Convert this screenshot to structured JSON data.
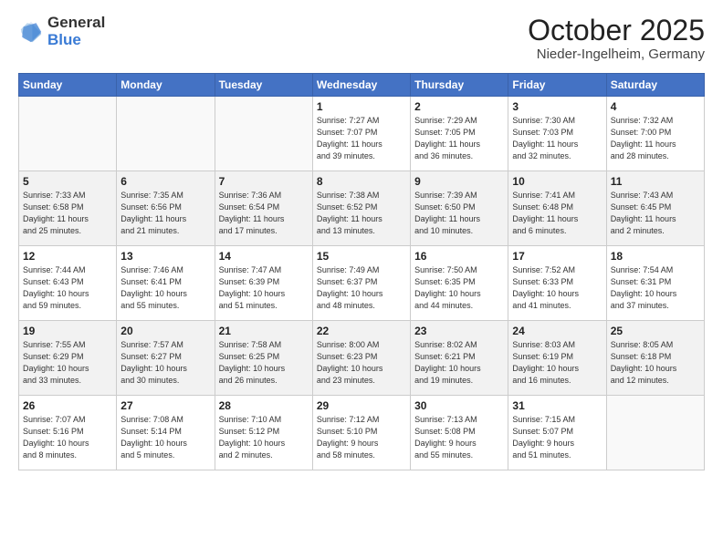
{
  "header": {
    "logo_general": "General",
    "logo_blue": "Blue",
    "title": "October 2025",
    "subtitle": "Nieder-Ingelheim, Germany"
  },
  "days_of_week": [
    "Sunday",
    "Monday",
    "Tuesday",
    "Wednesday",
    "Thursday",
    "Friday",
    "Saturday"
  ],
  "weeks": [
    [
      {
        "day": "",
        "info": ""
      },
      {
        "day": "",
        "info": ""
      },
      {
        "day": "",
        "info": ""
      },
      {
        "day": "1",
        "info": "Sunrise: 7:27 AM\nSunset: 7:07 PM\nDaylight: 11 hours\nand 39 minutes."
      },
      {
        "day": "2",
        "info": "Sunrise: 7:29 AM\nSunset: 7:05 PM\nDaylight: 11 hours\nand 36 minutes."
      },
      {
        "day": "3",
        "info": "Sunrise: 7:30 AM\nSunset: 7:03 PM\nDaylight: 11 hours\nand 32 minutes."
      },
      {
        "day": "4",
        "info": "Sunrise: 7:32 AM\nSunset: 7:00 PM\nDaylight: 11 hours\nand 28 minutes."
      }
    ],
    [
      {
        "day": "5",
        "info": "Sunrise: 7:33 AM\nSunset: 6:58 PM\nDaylight: 11 hours\nand 25 minutes."
      },
      {
        "day": "6",
        "info": "Sunrise: 7:35 AM\nSunset: 6:56 PM\nDaylight: 11 hours\nand 21 minutes."
      },
      {
        "day": "7",
        "info": "Sunrise: 7:36 AM\nSunset: 6:54 PM\nDaylight: 11 hours\nand 17 minutes."
      },
      {
        "day": "8",
        "info": "Sunrise: 7:38 AM\nSunset: 6:52 PM\nDaylight: 11 hours\nand 13 minutes."
      },
      {
        "day": "9",
        "info": "Sunrise: 7:39 AM\nSunset: 6:50 PM\nDaylight: 11 hours\nand 10 minutes."
      },
      {
        "day": "10",
        "info": "Sunrise: 7:41 AM\nSunset: 6:48 PM\nDaylight: 11 hours\nand 6 minutes."
      },
      {
        "day": "11",
        "info": "Sunrise: 7:43 AM\nSunset: 6:45 PM\nDaylight: 11 hours\nand 2 minutes."
      }
    ],
    [
      {
        "day": "12",
        "info": "Sunrise: 7:44 AM\nSunset: 6:43 PM\nDaylight: 10 hours\nand 59 minutes."
      },
      {
        "day": "13",
        "info": "Sunrise: 7:46 AM\nSunset: 6:41 PM\nDaylight: 10 hours\nand 55 minutes."
      },
      {
        "day": "14",
        "info": "Sunrise: 7:47 AM\nSunset: 6:39 PM\nDaylight: 10 hours\nand 51 minutes."
      },
      {
        "day": "15",
        "info": "Sunrise: 7:49 AM\nSunset: 6:37 PM\nDaylight: 10 hours\nand 48 minutes."
      },
      {
        "day": "16",
        "info": "Sunrise: 7:50 AM\nSunset: 6:35 PM\nDaylight: 10 hours\nand 44 minutes."
      },
      {
        "day": "17",
        "info": "Sunrise: 7:52 AM\nSunset: 6:33 PM\nDaylight: 10 hours\nand 41 minutes."
      },
      {
        "day": "18",
        "info": "Sunrise: 7:54 AM\nSunset: 6:31 PM\nDaylight: 10 hours\nand 37 minutes."
      }
    ],
    [
      {
        "day": "19",
        "info": "Sunrise: 7:55 AM\nSunset: 6:29 PM\nDaylight: 10 hours\nand 33 minutes."
      },
      {
        "day": "20",
        "info": "Sunrise: 7:57 AM\nSunset: 6:27 PM\nDaylight: 10 hours\nand 30 minutes."
      },
      {
        "day": "21",
        "info": "Sunrise: 7:58 AM\nSunset: 6:25 PM\nDaylight: 10 hours\nand 26 minutes."
      },
      {
        "day": "22",
        "info": "Sunrise: 8:00 AM\nSunset: 6:23 PM\nDaylight: 10 hours\nand 23 minutes."
      },
      {
        "day": "23",
        "info": "Sunrise: 8:02 AM\nSunset: 6:21 PM\nDaylight: 10 hours\nand 19 minutes."
      },
      {
        "day": "24",
        "info": "Sunrise: 8:03 AM\nSunset: 6:19 PM\nDaylight: 10 hours\nand 16 minutes."
      },
      {
        "day": "25",
        "info": "Sunrise: 8:05 AM\nSunset: 6:18 PM\nDaylight: 10 hours\nand 12 minutes."
      }
    ],
    [
      {
        "day": "26",
        "info": "Sunrise: 7:07 AM\nSunset: 5:16 PM\nDaylight: 10 hours\nand 8 minutes."
      },
      {
        "day": "27",
        "info": "Sunrise: 7:08 AM\nSunset: 5:14 PM\nDaylight: 10 hours\nand 5 minutes."
      },
      {
        "day": "28",
        "info": "Sunrise: 7:10 AM\nSunset: 5:12 PM\nDaylight: 10 hours\nand 2 minutes."
      },
      {
        "day": "29",
        "info": "Sunrise: 7:12 AM\nSunset: 5:10 PM\nDaylight: 9 hours\nand 58 minutes."
      },
      {
        "day": "30",
        "info": "Sunrise: 7:13 AM\nSunset: 5:08 PM\nDaylight: 9 hours\nand 55 minutes."
      },
      {
        "day": "31",
        "info": "Sunrise: 7:15 AM\nSunset: 5:07 PM\nDaylight: 9 hours\nand 51 minutes."
      },
      {
        "day": "",
        "info": ""
      }
    ]
  ]
}
